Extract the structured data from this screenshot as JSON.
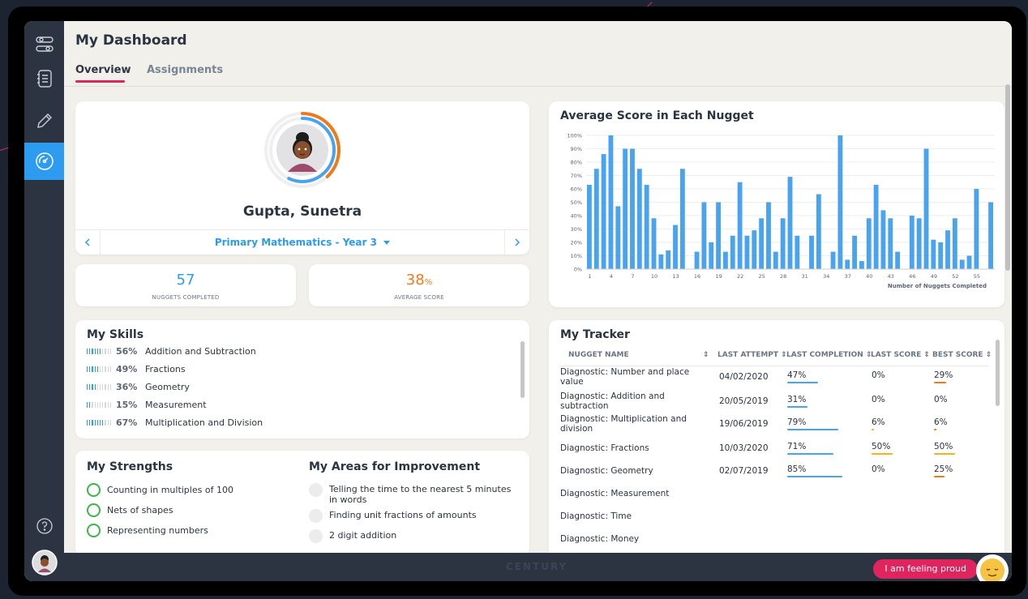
{
  "page": {
    "title": "My Dashboard"
  },
  "tabs": [
    {
      "label": "Overview"
    },
    {
      "label": "Assignments"
    }
  ],
  "sidebar": {
    "items": [
      {
        "icon": "toggles-icon"
      },
      {
        "icon": "notebook-icon"
      },
      {
        "icon": "pencil-icon"
      },
      {
        "icon": "dashboard-gauge-icon"
      }
    ],
    "help_icon": "help-icon",
    "avatar_icon": "avatar"
  },
  "profile": {
    "name": "Gupta, Sunetra",
    "course": "Primary Mathematics - Year 3",
    "ring_progress_orange": 0.38,
    "ring_progress_blue": 0.57
  },
  "stats": {
    "nuggets_completed": {
      "value": "57",
      "label": "NUGGETS COMPLETED"
    },
    "average_score": {
      "value": "38",
      "suffix": "%",
      "label": "AVERAGE SCORE"
    }
  },
  "skills": {
    "title": "My Skills",
    "items": [
      {
        "pct": "56%",
        "name": "Addition and Subtraction",
        "level": 0.56
      },
      {
        "pct": "49%",
        "name": "Fractions",
        "level": 0.49
      },
      {
        "pct": "36%",
        "name": "Geometry",
        "level": 0.36
      },
      {
        "pct": "15%",
        "name": "Measurement",
        "level": 0.15
      },
      {
        "pct": "67%",
        "name": "Multiplication and Division",
        "level": 0.67
      }
    ]
  },
  "strengths": {
    "title": "My Strengths",
    "items": [
      "Counting in multiples of 100",
      "Nets of shapes",
      "Representing numbers"
    ]
  },
  "improvements": {
    "title": "My Areas for Improvement",
    "items": [
      "Telling the time to the nearest 5 minutes in words",
      "Finding unit fractions of amounts",
      "2 digit addition"
    ]
  },
  "chart_data": {
    "type": "bar",
    "title": "Average Score in Each Nugget",
    "xlabel": "Number of Nuggets Completed",
    "ylabel": "",
    "ylim": [
      0,
      100
    ],
    "y_ticks": [
      "0%",
      "10%",
      "20%",
      "30%",
      "40%",
      "50%",
      "60%",
      "70%",
      "80%",
      "90%",
      "100%"
    ],
    "x_ticks": [
      "1",
      "4",
      "7",
      "10",
      "13",
      "16",
      "19",
      "22",
      "25",
      "28",
      "31",
      "34",
      "37",
      "40",
      "43",
      "46",
      "49",
      "52",
      "55"
    ],
    "bar_color": "#4aa3ee",
    "values": [
      63,
      75,
      86,
      100,
      47,
      90,
      90,
      75,
      63,
      38,
      11,
      14,
      33,
      75,
      0,
      13,
      50,
      20,
      50,
      13,
      25,
      65,
      25,
      29,
      38,
      50,
      13,
      38,
      69,
      25,
      0,
      25,
      56,
      0,
      13,
      100,
      7,
      25,
      6,
      38,
      63,
      44,
      38,
      13,
      0,
      40,
      38,
      90,
      22,
      20,
      29,
      38,
      7,
      10,
      60,
      0,
      50
    ]
  },
  "tracker": {
    "title": "My Tracker",
    "headers": [
      "NUGGET NAME",
      "LAST ATTEMPT",
      "LAST COMPLETION",
      "LAST SCORE",
      "BEST SCORE"
    ],
    "rows": [
      {
        "name": "Diagnostic: Number and place value",
        "last_attempt": "04/02/2020",
        "last_completion": "47%",
        "last_score": "0%",
        "best_score": "29%",
        "completion_level": 0.47,
        "last_level": 0,
        "best_level": 0.29
      },
      {
        "name": "Diagnostic: Addition and subtraction",
        "last_attempt": "20/05/2019",
        "last_completion": "31%",
        "last_score": "0%",
        "best_score": "0%",
        "completion_level": 0.31,
        "last_level": 0,
        "best_level": 0
      },
      {
        "name": "Diagnostic: Multiplication and division",
        "last_attempt": "19/06/2019",
        "last_completion": "79%",
        "last_score": "6%",
        "best_score": "6%",
        "completion_level": 0.79,
        "last_level": 0.06,
        "best_level": 0.06
      },
      {
        "name": "Diagnostic: Fractions",
        "last_attempt": "10/03/2020",
        "last_completion": "71%",
        "last_score": "50%",
        "best_score": "50%",
        "completion_level": 0.71,
        "last_level": 0.5,
        "best_level": 0.5
      },
      {
        "name": "Diagnostic: Geometry",
        "last_attempt": "02/07/2019",
        "last_completion": "85%",
        "last_score": "0%",
        "best_score": "25%",
        "completion_level": 0.85,
        "last_level": 0,
        "best_level": 0.25
      },
      {
        "name": "Diagnostic: Measurement",
        "last_attempt": "",
        "last_completion": "",
        "last_score": "",
        "best_score": ""
      },
      {
        "name": "Diagnostic: Time",
        "last_attempt": "",
        "last_completion": "",
        "last_score": "",
        "best_score": ""
      },
      {
        "name": "Diagnostic: Money",
        "last_attempt": "",
        "last_completion": "",
        "last_score": "",
        "best_score": ""
      }
    ]
  },
  "footer": {
    "brand": "CENTURY",
    "feeling_button": "I am feeling proud",
    "feeling_icon": "relieved-face-emoji-icon"
  },
  "colors": {
    "accent": "#e0245e",
    "blue": "#2d9cf0",
    "orange": "#f07a1a",
    "green": "#3cb54a",
    "dark": "#2c3441"
  }
}
